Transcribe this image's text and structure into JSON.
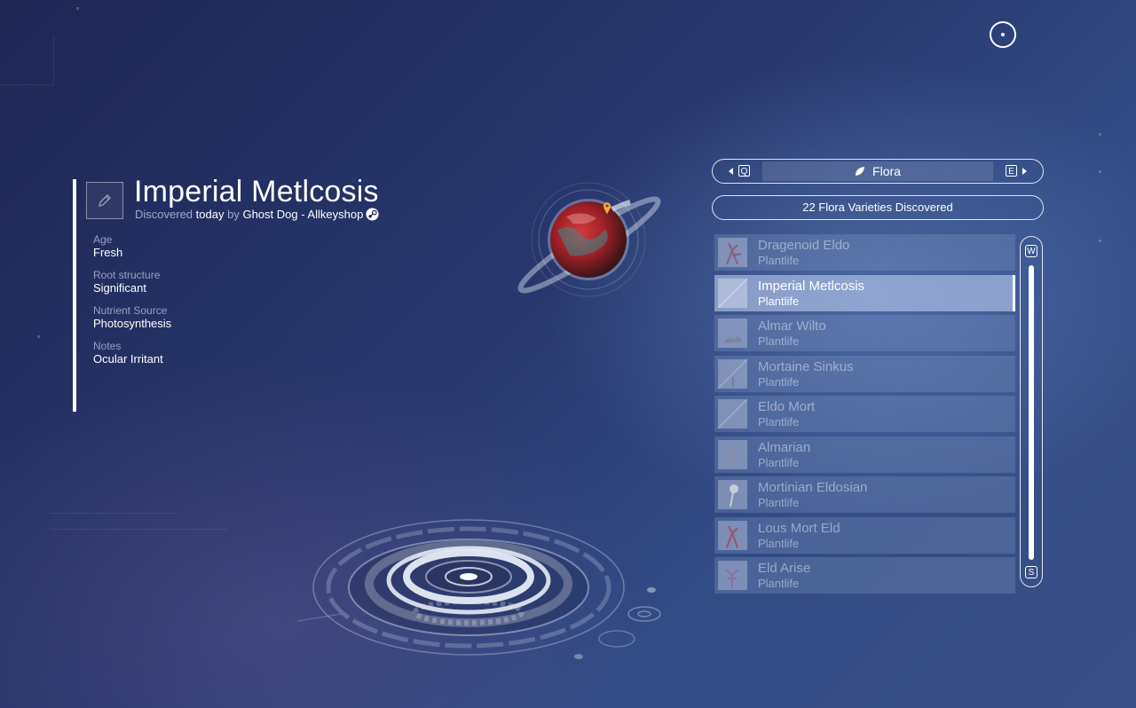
{
  "detail": {
    "title": "Imperial Metlcosis",
    "discovered_prefix": "Discovered",
    "discovered_when": "today",
    "discovered_by_word": "by",
    "discoverer": "Ghost Dog - Allkeyshop",
    "attributes": [
      {
        "label": "Age",
        "value": "Fresh"
      },
      {
        "label": "Root structure",
        "value": "Significant"
      },
      {
        "label": "Nutrient Source",
        "value": "Photosynthesis"
      },
      {
        "label": "Notes",
        "value": "Ocular Irritant"
      }
    ]
  },
  "category_nav": {
    "prev_key": "Q",
    "next_key": "E",
    "label": "Flora",
    "icon": "leaf-icon"
  },
  "summary": "22 Flora Varieties Discovered",
  "list": {
    "items": [
      {
        "name": "Dragenoid Eldo",
        "type": "Plantlife",
        "selected": false
      },
      {
        "name": "Imperial Metlcosis",
        "type": "Plantlife",
        "selected": true
      },
      {
        "name": "Almar Wilto",
        "type": "Plantlife",
        "selected": false
      },
      {
        "name": "Mortaine Sinkus",
        "type": "Plantlife",
        "selected": false
      },
      {
        "name": "Eldo Mort",
        "type": "Plantlife",
        "selected": false
      },
      {
        "name": "Almarian",
        "type": "Plantlife",
        "selected": false
      },
      {
        "name": "Mortinian Eldosian",
        "type": "Plantlife",
        "selected": false
      },
      {
        "name": "Lous Mort Eld",
        "type": "Plantlife",
        "selected": false
      },
      {
        "name": "Eld Arise",
        "type": "Plantlife",
        "selected": false
      }
    ]
  },
  "scrollbar": {
    "up_key": "W",
    "down_key": "S"
  },
  "colors": {
    "accent": "#ffffff",
    "planet_red": "#b3232b",
    "marker": "#f2a93b"
  }
}
